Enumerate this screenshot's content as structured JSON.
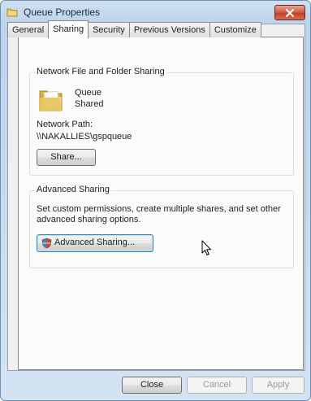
{
  "window": {
    "title": "Queue Properties"
  },
  "tabs": [
    {
      "label": "General"
    },
    {
      "label": "Sharing"
    },
    {
      "label": "Security"
    },
    {
      "label": "Previous Versions"
    },
    {
      "label": "Customize"
    }
  ],
  "network_sharing": {
    "group_label": "Network File and Folder Sharing",
    "folder_name": "Queue",
    "folder_status": "Shared",
    "path_label": "Network Path:",
    "path_value": "\\\\NAKALLIES\\gspqueue",
    "share_button": "Share..."
  },
  "advanced_sharing": {
    "group_label": "Advanced Sharing",
    "description": "Set custom permissions, create multiple shares, and set other advanced sharing options.",
    "description_line1": "Set custom permissions, create multiple shares, and set other",
    "description_line2": "advanced sharing options.",
    "button": "Advanced Sharing..."
  },
  "footer": {
    "close": "Close",
    "cancel": "Cancel",
    "apply": "Apply"
  },
  "colors": {
    "titlebar": "#bcd3ea",
    "close_button": "#c2402a",
    "dialog_bg": "#f0f0f0"
  }
}
